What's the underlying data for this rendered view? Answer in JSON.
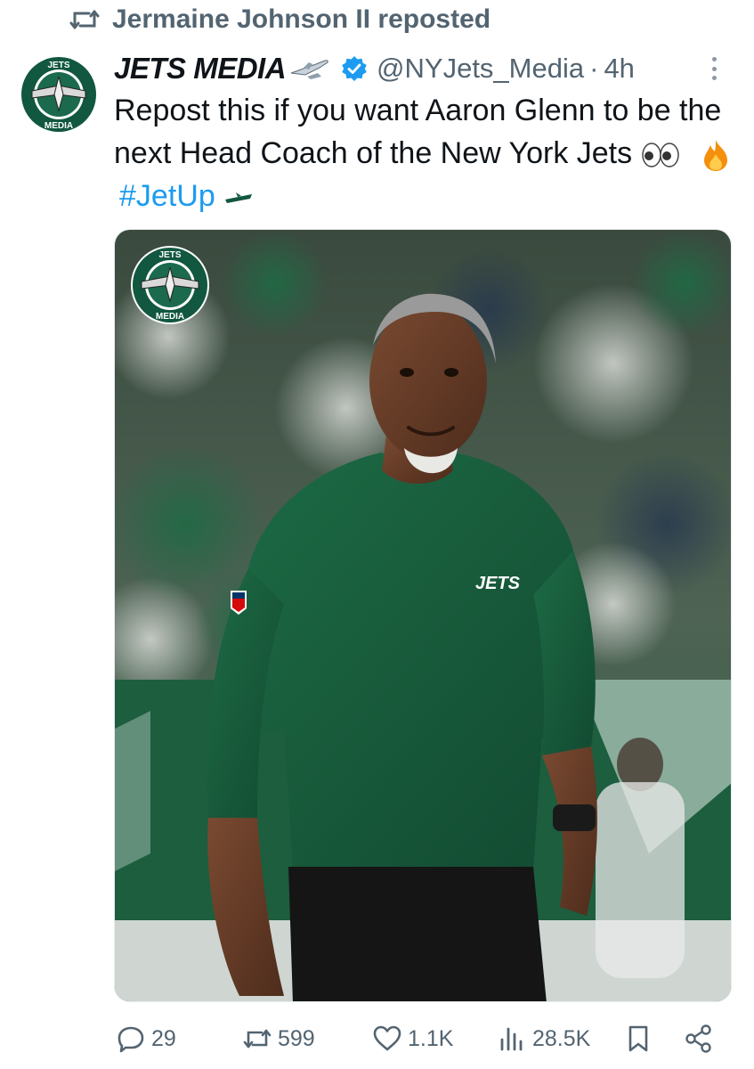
{
  "repost_banner": {
    "text": "Jermaine Johnson II reposted",
    "icon": "repost-icon"
  },
  "post": {
    "display_name": "JETS MEDIA",
    "handle": "@NYJets_Media",
    "separator": "·",
    "time": "4h",
    "text_main": "Repost this if you want Aaron Glenn to be the next Head Coach of the New York Jets",
    "emojis": [
      "eyes-emoji",
      "fire-emoji"
    ],
    "hashtag": "#JetUp",
    "avatar_ring_text_top": "JETS",
    "avatar_ring_text_bottom": "MEDIA"
  },
  "media": {
    "logo_text_top": "JETS",
    "logo_text_bottom": "MEDIA",
    "shirt_logo_text": "JETS"
  },
  "actions": {
    "replies": "29",
    "reposts": "599",
    "likes": "1.1K",
    "views": "28.5K"
  },
  "colors": {
    "jets_green": "#125740",
    "link_blue": "#1d9bf0",
    "muted_gray": "#536471"
  }
}
